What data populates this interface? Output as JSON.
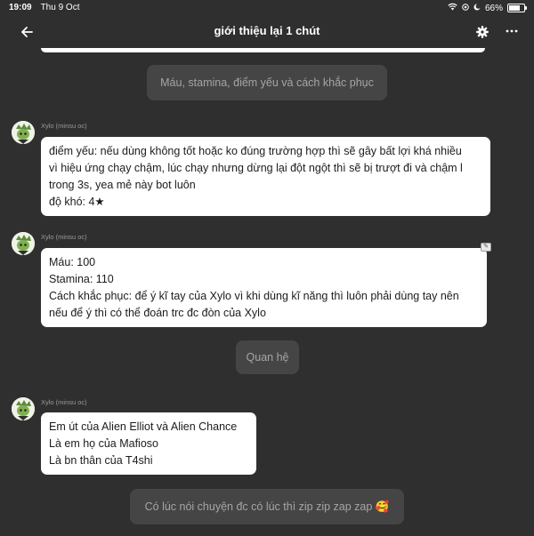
{
  "status_bar": {
    "time": "19:09",
    "date": "Thu 9 Oct",
    "battery": "66%"
  },
  "header": {
    "title": "giới thiệu lại 1 chút",
    "back_icon": "arrow-left-icon",
    "settings_icon": "gear-icon",
    "more_icon": "more-dots-icon"
  },
  "messages": {
    "narration_1": "Máu, stamina, điểm yếu và cách khắc phục",
    "character_name": "Xylo (minsu oc)",
    "msg1": [
      "điểm yếu: nếu dùng không tốt hoặc ko đúng trường hợp thì sẽ gây bất lợi khá nhiều",
      "vì hiệu ứng chạy chậm, lúc chạy nhưng dừng lại đột ngột thì sẽ bị trượt đi và chậm l",
      "trong 3s, yea mẻ này bot luôn",
      "độ khó: 4★"
    ],
    "msg2": [
      "Máu: 100",
      "Stamina: 110",
      "Cách khắc phục: để ý kĩ tay của Xylo vì khi dùng kĩ năng thì luôn phải dùng tay nên",
      "nếu để ý thì có thể đoán trc đc đòn của Xylo"
    ],
    "narration_2": "Quan hệ",
    "msg3": [
      "Em út của Alien Elliot và Alien Chance",
      "Là em họ của Mafioso",
      "Là bn thân của T4shi"
    ],
    "narration_3": "Có lúc nói chuyện đc có lúc thì zip zip zap zap 🥰"
  }
}
